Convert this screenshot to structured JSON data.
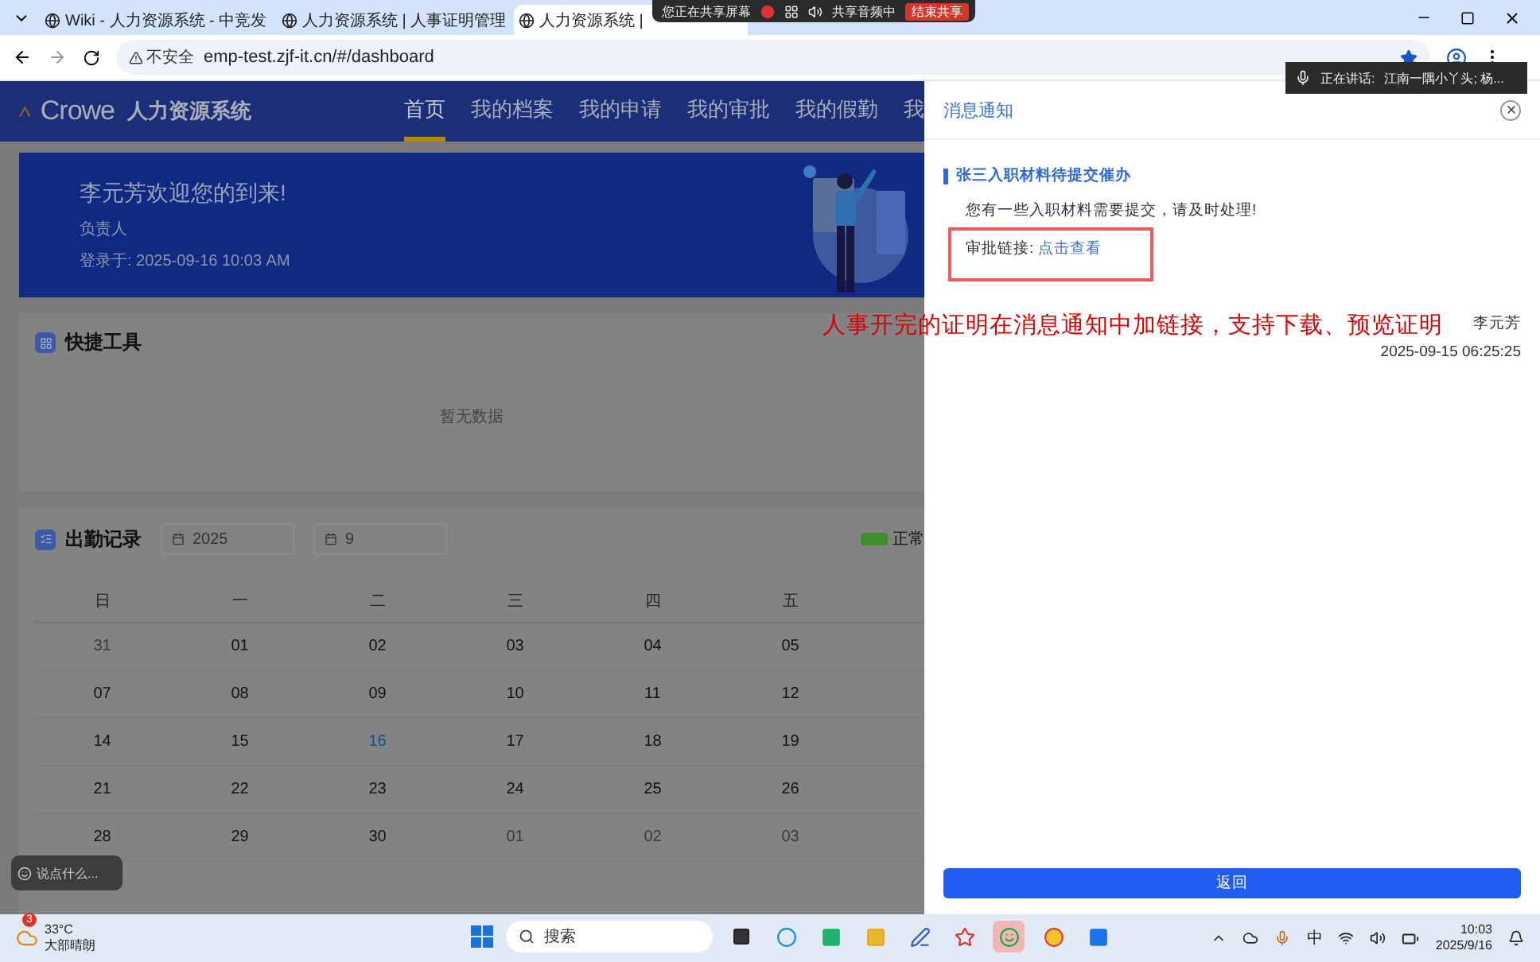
{
  "browser": {
    "tabs": [
      {
        "title": "Wiki - 人力资源系统 - 中竞发",
        "selected": false
      },
      {
        "title": "人力资源系统 | 人事证明管理",
        "selected": false
      },
      {
        "title": "人力资源系统 |",
        "selected": true
      }
    ],
    "security": "不安全",
    "url": "emp-test.zjf-it.cn/#/dashboard"
  },
  "share_bar": {
    "status": "您正在共享屏幕",
    "audio": "共享音频中",
    "stop_button": "结束共享"
  },
  "speaking": {
    "label": "正在讲话:",
    "names": "江南一隅小丫头; 杨..."
  },
  "app": {
    "brand": "Crowe",
    "system_name": "人力资源系统",
    "nav": [
      {
        "label": "首页",
        "selected": true
      },
      {
        "label": "我的档案",
        "selected": false
      },
      {
        "label": "我的申请",
        "selected": false
      },
      {
        "label": "我的审批",
        "selected": false
      },
      {
        "label": "我的假勤",
        "selected": false
      },
      {
        "label": "我",
        "selected": false
      }
    ],
    "welcome": {
      "greeting": "李元芳欢迎您的到来!",
      "role": "负责人",
      "login": "登录于:  2025-09-16 10:03 AM"
    },
    "shortcuts": {
      "title": "快捷工具",
      "empty": "暂无数据"
    },
    "attendance": {
      "title": "出勤记录",
      "year": "2025",
      "month": "9",
      "legend": [
        {
          "label": "正常",
          "color": "#3f8f2f"
        }
      ],
      "weekdays": [
        "日",
        "一",
        "二",
        "三",
        "四",
        "五"
      ],
      "weeks": [
        [
          {
            "day": "31",
            "kind": "other"
          },
          {
            "day": "01",
            "kind": "normal"
          },
          {
            "day": "02",
            "kind": "normal"
          },
          {
            "day": "03",
            "kind": "normal"
          },
          {
            "day": "04",
            "kind": "normal"
          },
          {
            "day": "05",
            "kind": "normal"
          }
        ],
        [
          {
            "day": "07",
            "kind": "normal"
          },
          {
            "day": "08",
            "kind": "normal"
          },
          {
            "day": "09",
            "kind": "normal"
          },
          {
            "day": "10",
            "kind": "normal"
          },
          {
            "day": "11",
            "kind": "normal"
          },
          {
            "day": "12",
            "kind": "normal"
          }
        ],
        [
          {
            "day": "14",
            "kind": "normal"
          },
          {
            "day": "15",
            "kind": "normal"
          },
          {
            "day": "16",
            "kind": "today"
          },
          {
            "day": "17",
            "kind": "normal"
          },
          {
            "day": "18",
            "kind": "normal"
          },
          {
            "day": "19",
            "kind": "normal"
          }
        ],
        [
          {
            "day": "21",
            "kind": "normal"
          },
          {
            "day": "22",
            "kind": "normal"
          },
          {
            "day": "23",
            "kind": "normal"
          },
          {
            "day": "24",
            "kind": "normal"
          },
          {
            "day": "25",
            "kind": "normal"
          },
          {
            "day": "26",
            "kind": "normal"
          }
        ],
        [
          {
            "day": "28",
            "kind": "normal"
          },
          {
            "day": "29",
            "kind": "normal"
          },
          {
            "day": "30",
            "kind": "normal"
          },
          {
            "day": "01",
            "kind": "other"
          },
          {
            "day": "02",
            "kind": "other"
          },
          {
            "day": "03",
            "kind": "other"
          }
        ]
      ]
    }
  },
  "chat_bubble": {
    "text": "说点什么..."
  },
  "annotation": {
    "text": "人事开完的证明在消息通知中加链接，支持下载、预览证明"
  },
  "drawer": {
    "title": "消息通知",
    "message": {
      "title": "张三入职材料待提交催办",
      "body": "您有一些入职材料需要提交，请及时处理!",
      "link_label": "审批链接:",
      "link": "点击查看",
      "sender": "李元芳",
      "time": "2025-09-15 06:25:25"
    },
    "back_button": "返回"
  },
  "taskbar": {
    "weather": {
      "badge": "3",
      "temp": "33°C",
      "desc": "大部晴朗"
    },
    "search": {
      "placeholder": "搜索"
    },
    "input_method": "中",
    "time": "10:03",
    "date": "2025/9/16"
  }
}
